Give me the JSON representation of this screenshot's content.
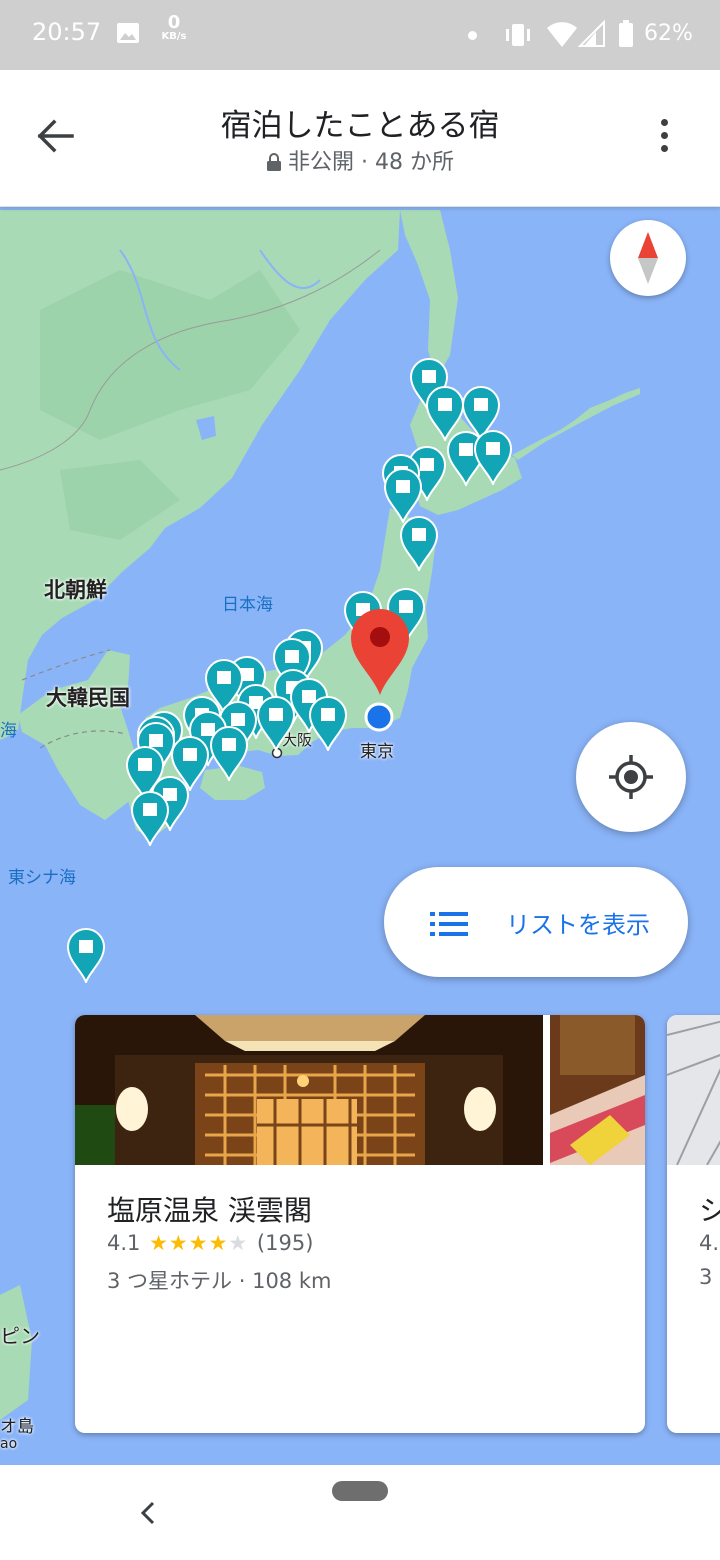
{
  "status_bar": {
    "time": "20:57",
    "net_speed_value": "0",
    "net_speed_unit": "KB/s",
    "battery": "62%"
  },
  "header": {
    "back_icon": "arrow-back-icon",
    "title": "宿泊したことある宿",
    "visibility": "非公開",
    "separator": " · ",
    "count": "48 か所",
    "menu_icon": "more-vert-icon"
  },
  "map": {
    "labels": {
      "north_korea": "北朝鮮",
      "south_korea": "大韓民国",
      "sea_of_japan": "日本海",
      "east_china_sea": "東シナ海",
      "tokyo": "東京",
      "osaka_partial": "大阪",
      "sea_partial": "海",
      "philippines_partial": "ピン",
      "island_partial": "オ島",
      "island_roman_partial": "ao"
    },
    "colors": {
      "water": "#8ab4f8",
      "land": "#a8dab5",
      "pin": "#12a5b5",
      "selected_pin": "#ea4335",
      "my_location": "#1a73e8"
    },
    "saved_place_count": 48
  },
  "controls": {
    "compass_icon": "compass-icon",
    "my_location_icon": "my-location-icon",
    "list_button_label": "リストを表示",
    "list_icon": "list-icon"
  },
  "cards": [
    {
      "name": "塩原温泉 渓雲閣",
      "rating": "4.1",
      "stars_filled": 4,
      "reviews": "(195)",
      "category": "3 つ星ホテル",
      "separator": " · ",
      "distance": "108 km"
    },
    {
      "name_partial": "シ",
      "rating_partial": "4.",
      "category_partial": "3"
    }
  ],
  "nav": {
    "back_icon": "nav-back-icon",
    "home_icon": "home-pill-icon"
  }
}
